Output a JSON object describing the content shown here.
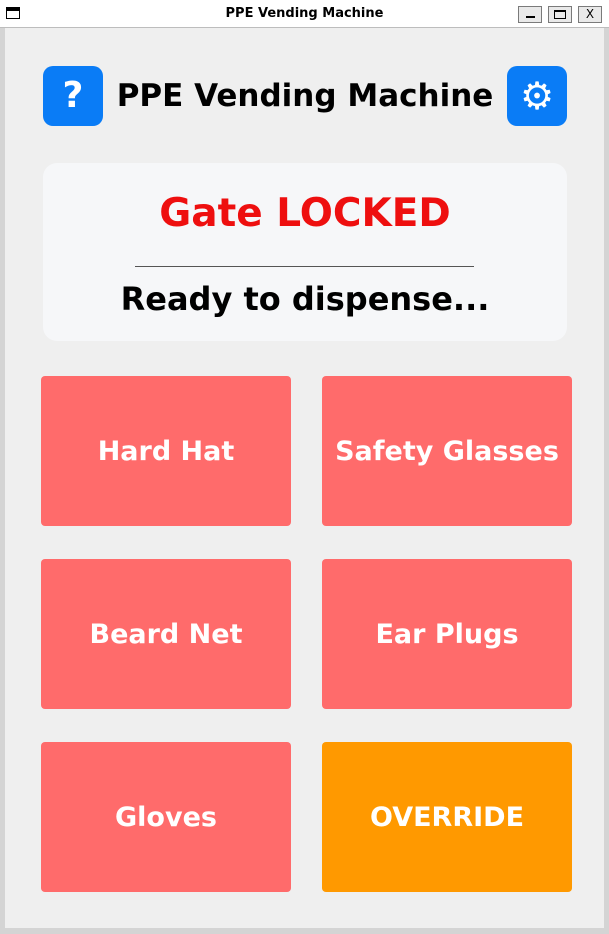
{
  "window": {
    "title": "PPE Vending Machine",
    "controls": {
      "minimize": "_",
      "maximize": "□",
      "close": "X"
    }
  },
  "header": {
    "title": "PPE Vending Machine",
    "help_label": "?",
    "settings_icon": "⚙"
  },
  "status": {
    "gate": "Gate LOCKED",
    "message": "Ready to dispense..."
  },
  "buttons": [
    {
      "label": "Hard Hat"
    },
    {
      "label": "Safety Glasses"
    },
    {
      "label": "Beard Net"
    },
    {
      "label": "Ear Plugs"
    },
    {
      "label": "Gloves"
    },
    {
      "label": "OVERRIDE"
    }
  ],
  "colors": {
    "accent_blue": "#0a7cf6",
    "gate_locked_red": "#ee0f0f",
    "item_button": "#ff6b6b",
    "override_button": "#ff9900"
  }
}
